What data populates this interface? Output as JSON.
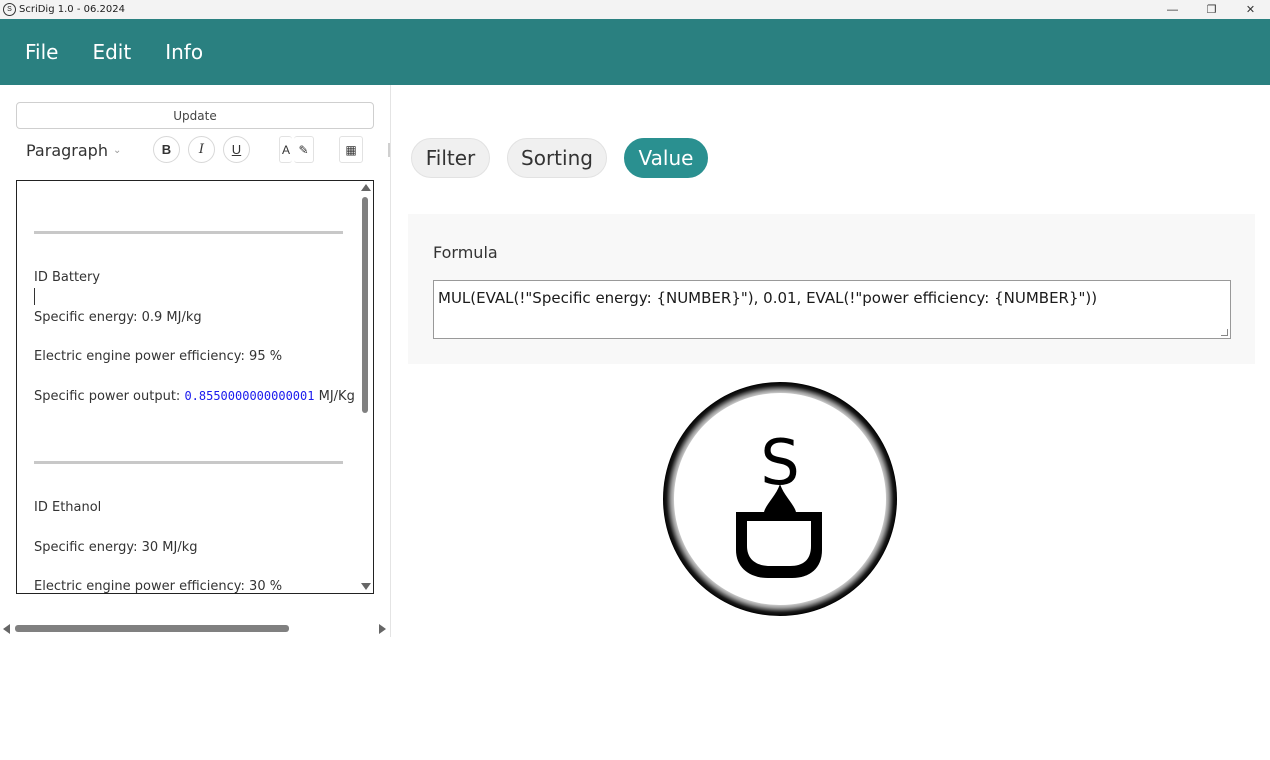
{
  "window": {
    "title": "ScriDig 1.0 - 06.2024",
    "controls": {
      "minimize_icon": "minimize-icon",
      "restore_icon": "restore-icon",
      "close_icon": "close-icon"
    }
  },
  "menu": {
    "items": [
      "File",
      "Edit",
      "Info"
    ]
  },
  "left_panel": {
    "update_label": "Update",
    "toolbar": {
      "paragraph_label": "Paragraph",
      "bold_label": "B",
      "italic_label": "I",
      "underline_label": "U",
      "font_color_label": "A"
    },
    "editor": {
      "records": [
        {
          "id_line": "ID Battery",
          "energy_line": "Specific energy: 0.9 MJ/kg",
          "efficiency_line": "Electric engine power efficiency: 95 %",
          "power_prefix": "Specific power output: ",
          "power_value": "0.8550000000000001",
          "power_suffix": " MJ/Kg"
        },
        {
          "id_line": "ID Ethanol",
          "energy_line": "Specific energy: 30 MJ/kg",
          "efficiency_line": "Electric engine power efficiency: 30 %"
        }
      ]
    }
  },
  "right_panel": {
    "tabs": [
      {
        "label": "Filter",
        "active": false
      },
      {
        "label": "Sorting",
        "active": false
      },
      {
        "label": "Value",
        "active": true
      }
    ],
    "formula": {
      "label": "Formula",
      "value": "MUL(EVAL(!\"Specific energy: {NUMBER}\"), 0.01, EVAL(!\"power efficiency: {NUMBER}\"))"
    },
    "logo_letter": "S"
  },
  "colors": {
    "accent": "#2a8080",
    "tab_active": "#2a9090",
    "value_highlight": "#1a1aee"
  }
}
